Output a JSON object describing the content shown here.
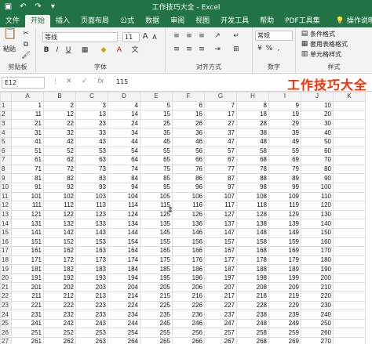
{
  "window": {
    "title": "工作技巧大全 - Excel",
    "qat": [
      "save-icon",
      "undo-icon",
      "redo-icon",
      "customize-icon"
    ]
  },
  "tabs": [
    "文件",
    "开始",
    "插入",
    "页面布局",
    "公式",
    "数据",
    "审阅",
    "视图",
    "开发工具",
    "帮助",
    "PDF工具集"
  ],
  "active_tab": "开始",
  "search": {
    "label": "操作说明搜索"
  },
  "ribbon": {
    "clipboard": {
      "paste_label": "粘贴",
      "group_label": "剪贴板"
    },
    "font": {
      "font_name": "等线",
      "font_size": "11",
      "group_label": "字体",
      "bold": "B",
      "italic": "I",
      "underline": "U",
      "grow": "A",
      "shrink": "A"
    },
    "alignment": {
      "group_label": "对齐方式"
    },
    "number": {
      "format": "常规",
      "group_label": "数字",
      "percent": "%",
      "comma": ","
    },
    "styles": {
      "conditional": "条件格式",
      "table": "套用表格格式",
      "cell": "单元格样式",
      "group_label": "样式"
    }
  },
  "formula_bar": {
    "name_box": "E12",
    "value": "115"
  },
  "watermark": "工作技巧大全",
  "grid": {
    "columns": [
      "A",
      "B",
      "C",
      "D",
      "E",
      "F",
      "G",
      "H",
      "I",
      "J",
      "K"
    ],
    "rows": [
      [
        1,
        2,
        3,
        4,
        5,
        6,
        7,
        8,
        9,
        10
      ],
      [
        11,
        12,
        13,
        14,
        15,
        16,
        17,
        18,
        19,
        20
      ],
      [
        21,
        22,
        23,
        24,
        25,
        26,
        27,
        28,
        29,
        30
      ],
      [
        31,
        32,
        33,
        34,
        35,
        36,
        37,
        38,
        39,
        40
      ],
      [
        41,
        42,
        43,
        44,
        45,
        46,
        47,
        48,
        49,
        50
      ],
      [
        51,
        52,
        53,
        54,
        55,
        56,
        57,
        58,
        59,
        60
      ],
      [
        61,
        62,
        63,
        64,
        65,
        66,
        67,
        68,
        69,
        70
      ],
      [
        71,
        72,
        73,
        74,
        75,
        76,
        77,
        78,
        79,
        80
      ],
      [
        81,
        82,
        83,
        84,
        85,
        86,
        87,
        88,
        89,
        90
      ],
      [
        91,
        92,
        93,
        94,
        95,
        96,
        97,
        98,
        99,
        100
      ],
      [
        101,
        102,
        103,
        104,
        105,
        106,
        107,
        108,
        109,
        110
      ],
      [
        111,
        112,
        113,
        114,
        115,
        116,
        117,
        118,
        119,
        120
      ],
      [
        121,
        122,
        123,
        124,
        125,
        126,
        127,
        128,
        129,
        130
      ],
      [
        131,
        132,
        133,
        134,
        135,
        136,
        137,
        138,
        139,
        140
      ],
      [
        141,
        142,
        143,
        144,
        145,
        146,
        147,
        148,
        149,
        150
      ],
      [
        151,
        152,
        153,
        154,
        155,
        156,
        157,
        158,
        159,
        160
      ],
      [
        161,
        162,
        163,
        164,
        165,
        166,
        167,
        168,
        169,
        170
      ],
      [
        171,
        172,
        173,
        174,
        175,
        176,
        177,
        178,
        179,
        180
      ],
      [
        181,
        182,
        183,
        184,
        185,
        186,
        187,
        188,
        189,
        190
      ],
      [
        191,
        192,
        193,
        194,
        195,
        196,
        197,
        198,
        199,
        200
      ],
      [
        201,
        202,
        203,
        204,
        205,
        206,
        207,
        208,
        209,
        210
      ],
      [
        211,
        212,
        213,
        214,
        215,
        216,
        217,
        218,
        219,
        220
      ],
      [
        221,
        222,
        223,
        224,
        225,
        226,
        227,
        228,
        229,
        230
      ],
      [
        231,
        232,
        233,
        234,
        235,
        236,
        237,
        238,
        239,
        240
      ],
      [
        241,
        242,
        243,
        244,
        245,
        246,
        247,
        248,
        249,
        250
      ],
      [
        251,
        252,
        253,
        254,
        255,
        256,
        257,
        258,
        259,
        260
      ],
      [
        261,
        262,
        263,
        264,
        265,
        266,
        267,
        268,
        269,
        270
      ]
    ]
  }
}
